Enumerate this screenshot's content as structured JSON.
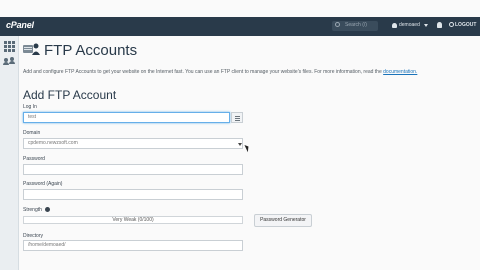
{
  "header": {
    "logo": "cPanel",
    "search_placeholder": "Search (/)",
    "username": "demoaed",
    "logout_label": "LOGOUT"
  },
  "page": {
    "title": "FTP Accounts",
    "intro": "Add and configure FTP Accounts to get your website on the Internet fast. You can use an FTP client to manage your website's files. For more information, read the",
    "doc_link": "documentation."
  },
  "form": {
    "section_title": "Add FTP Account",
    "login_label": "Log In",
    "login_value": "test",
    "domain_label": "Domain",
    "domain_value": "cpdemo.newzsoft.com",
    "password_label": "Password",
    "password_again_label": "Password (Again)",
    "strength_label": "Strength",
    "strength_text": "Very Weak (0/100)",
    "strength_value": 0,
    "generator_label": "Password Generator",
    "directory_label": "Directory",
    "directory_value": "/home/demoaed/"
  }
}
